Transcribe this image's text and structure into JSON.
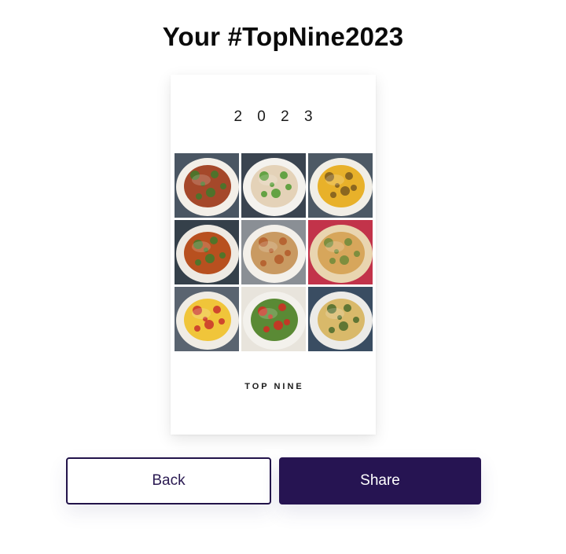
{
  "page": {
    "title": "Your #TopNine2023"
  },
  "card": {
    "year": "2 0 2 3",
    "footer": "TOP NINE",
    "tiles": [
      {
        "name": "photo-1",
        "plate": "#f3efe8",
        "food": "#a5482a",
        "garnish": "#3f7a2c",
        "bg": "#4a5663"
      },
      {
        "name": "photo-2",
        "plate": "#f4f2ee",
        "food": "#e4d2b8",
        "garnish": "#4e9a2f",
        "bg": "#3a4450"
      },
      {
        "name": "photo-3",
        "plate": "#f1eee6",
        "food": "#e8b12a",
        "garnish": "#7a5a1e",
        "bg": "#4d5965"
      },
      {
        "name": "photo-4",
        "plate": "#eeeae3",
        "food": "#b8501f",
        "garnish": "#3f7a2c",
        "bg": "#35404a"
      },
      {
        "name": "photo-5",
        "plate": "#f3f0ea",
        "food": "#c99a62",
        "garnish": "#b35a2a",
        "bg": "#8a8f95"
      },
      {
        "name": "photo-6",
        "plate": "#e9d5b0",
        "food": "#d7a65b",
        "garnish": "#6f8a3a",
        "bg": "#c2334a"
      },
      {
        "name": "photo-7",
        "plate": "#f0ece4",
        "food": "#f0c53a",
        "garnish": "#c9302c",
        "bg": "#5a6470"
      },
      {
        "name": "photo-8",
        "plate": "#f3f1ec",
        "food": "#5a8a35",
        "garnish": "#d42a22",
        "bg": "#e8e4dc"
      },
      {
        "name": "photo-9",
        "plate": "#ecebe8",
        "food": "#d9b96a",
        "garnish": "#4a6a2a",
        "bg": "#3a4d62"
      }
    ]
  },
  "actions": {
    "back_label": "Back",
    "share_label": "Share"
  },
  "colors": {
    "brand": "#261452",
    "text": "#0a0a0a"
  }
}
